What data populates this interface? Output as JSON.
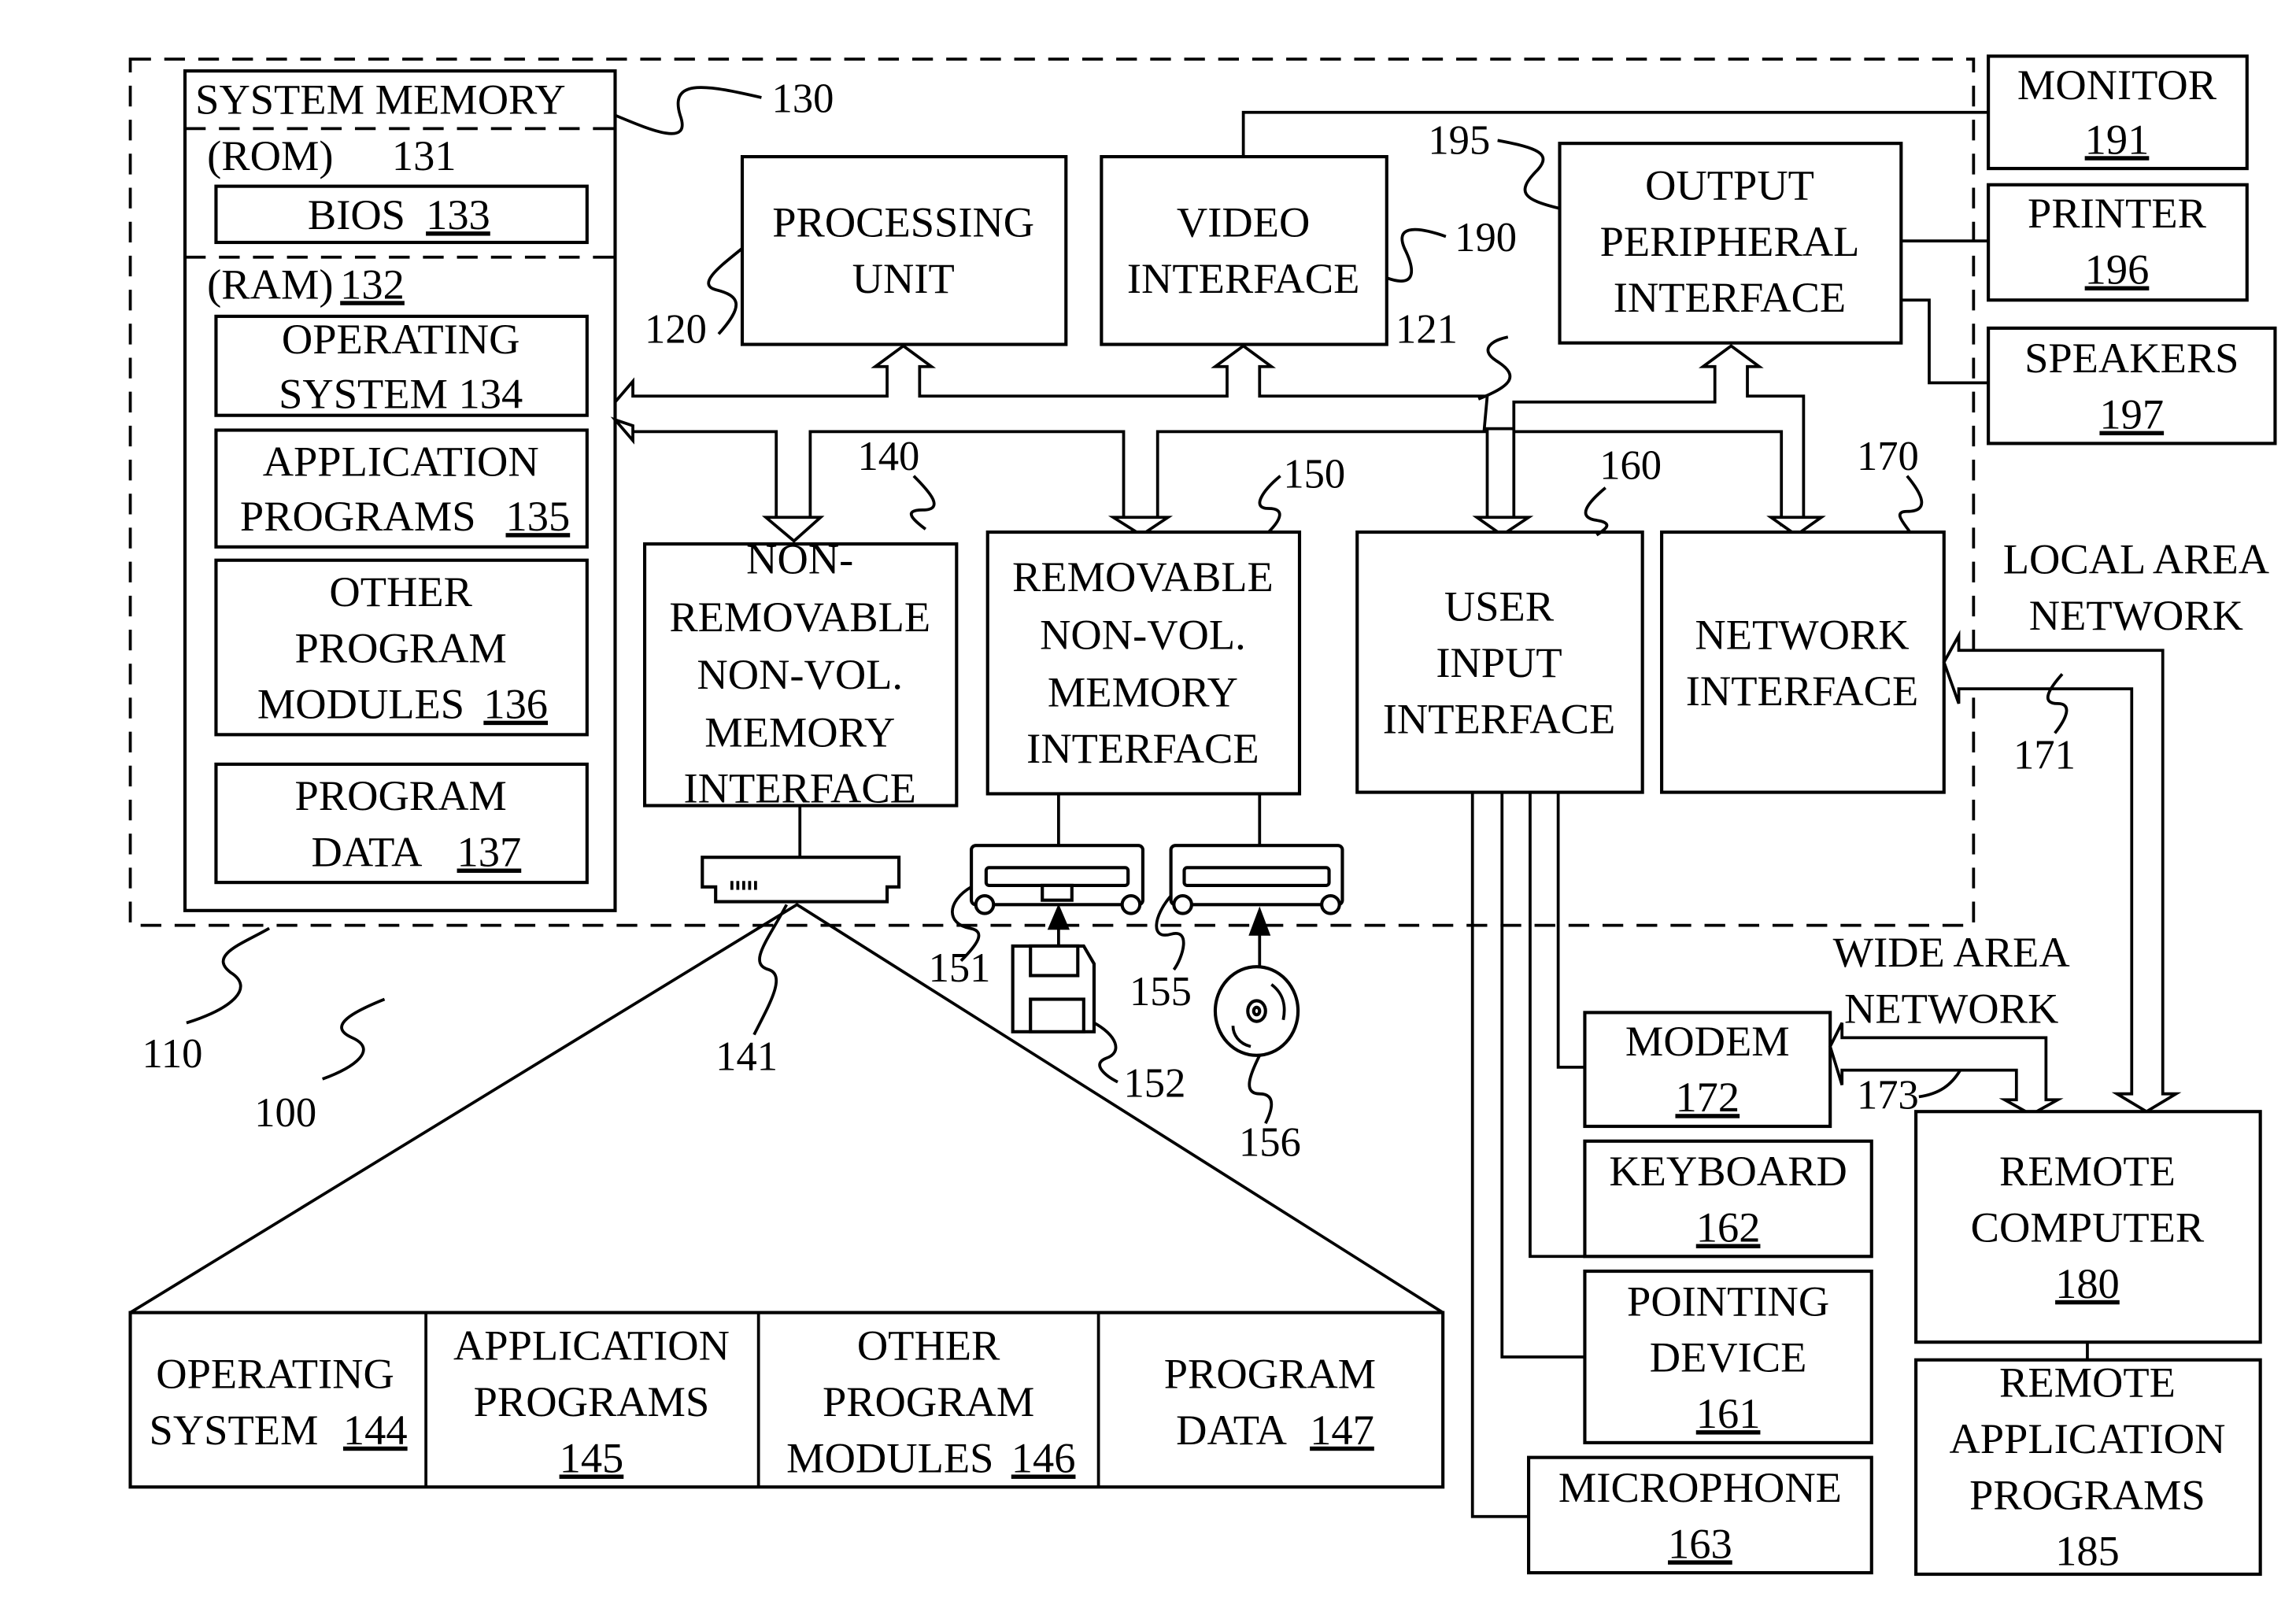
{
  "figure": {
    "system_ref": "100",
    "computer_ref": "110",
    "bus_ref": "121"
  },
  "system_memory": {
    "title": "SYSTEM MEMORY",
    "ref": "130",
    "rom": {
      "label": "(ROM)",
      "ref": "131"
    },
    "bios": {
      "label": "BIOS",
      "ref": "133"
    },
    "ram": {
      "label": "(RAM)",
      "ref": "132"
    },
    "items": [
      {
        "lines": [
          "OPERATING",
          "SYSTEM 134"
        ],
        "ref": "134"
      },
      {
        "lines": [
          "APPLICATION",
          "PROGRAMS"
        ],
        "ref": "135"
      },
      {
        "lines": [
          "OTHER",
          "PROGRAM",
          "MODULES"
        ],
        "ref": "136"
      },
      {
        "lines": [
          "PROGRAM",
          "DATA"
        ],
        "ref": "137"
      }
    ]
  },
  "processing_unit": {
    "lines": [
      "PROCESSING",
      "UNIT"
    ],
    "ref": "120"
  },
  "video_interface": {
    "lines": [
      "VIDEO",
      "INTERFACE"
    ],
    "ref": "190"
  },
  "output_peripheral_interface": {
    "lines": [
      "OUTPUT",
      "PERIPHERAL",
      "INTERFACE"
    ],
    "ref": "195"
  },
  "monitor": {
    "label": "MONITOR",
    "ref": "191"
  },
  "printer": {
    "label": "PRINTER",
    "ref": "196"
  },
  "speakers": {
    "label": "SPEAKERS",
    "ref": "197"
  },
  "non_removable_interface": {
    "lines": [
      "NON-",
      "REMOVABLE",
      "NON-VOL.",
      "MEMORY",
      "INTERFACE"
    ],
    "ref": "140"
  },
  "removable_interface": {
    "lines": [
      "REMOVABLE",
      "NON-VOL.",
      "MEMORY",
      "INTERFACE"
    ],
    "ref": "150"
  },
  "user_input_interface": {
    "lines": [
      "USER",
      "INPUT",
      "INTERFACE"
    ],
    "ref": "160"
  },
  "network_interface": {
    "lines": [
      "NETWORK",
      "INTERFACE"
    ],
    "ref": "170"
  },
  "lan": {
    "lines": [
      "LOCAL AREA",
      "NETWORK"
    ],
    "ref": "171"
  },
  "wan": {
    "lines": [
      "WIDE AREA",
      "NETWORK"
    ],
    "ref": "173"
  },
  "hard_disk": {
    "ref": "141"
  },
  "floppy_drive": {
    "ref": "151"
  },
  "floppy_disk": {
    "ref": "152"
  },
  "optical_drive": {
    "ref": "155"
  },
  "optical_disk": {
    "ref": "156"
  },
  "modem": {
    "label": "MODEM",
    "ref": "172"
  },
  "keyboard": {
    "label": "KEYBOARD",
    "ref": "162"
  },
  "pointing_device": {
    "lines": [
      "POINTING",
      "DEVICE"
    ],
    "ref": "161"
  },
  "microphone": {
    "label": "MICROPHONE",
    "ref": "163"
  },
  "remote_computer": {
    "lines": [
      "REMOTE",
      "COMPUTER"
    ],
    "ref": "180"
  },
  "remote_apps": {
    "lines": [
      "REMOTE",
      "APPLICATION",
      "PROGRAMS"
    ],
    "ref": "185"
  },
  "disk_contents": [
    {
      "lines": [
        "OPERATING",
        "SYSTEM"
      ],
      "ref": "144"
    },
    {
      "lines": [
        "APPLICATION",
        "PROGRAMS"
      ],
      "ref": "145"
    },
    {
      "lines": [
        "OTHER",
        "PROGRAM",
        "MODULES"
      ],
      "ref": "146"
    },
    {
      "lines": [
        "PROGRAM",
        "DATA"
      ],
      "ref": "147"
    }
  ]
}
